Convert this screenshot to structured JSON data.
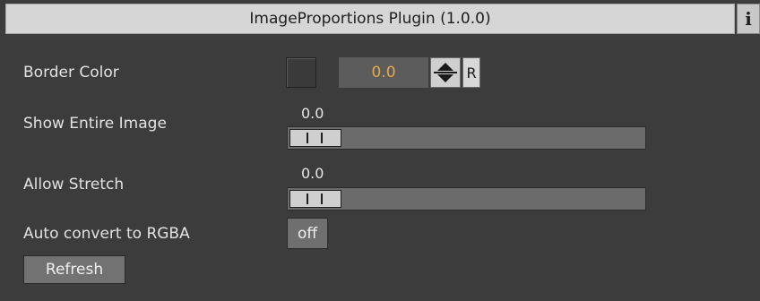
{
  "header": {
    "title": "ImageProportions Plugin (1.0.0)",
    "info_glyph": "i"
  },
  "border_color": {
    "label": "Border Color",
    "value": "0.0",
    "reset_label": "R",
    "swatch_color": "#3a3a3a",
    "value_color": "#e6a64a"
  },
  "show_entire_image": {
    "label": "Show Entire Image",
    "value": "0.0",
    "slider_fraction": 0.0
  },
  "allow_stretch": {
    "label": "Allow Stretch",
    "value": "0.0",
    "slider_fraction": 0.0
  },
  "auto_convert": {
    "label": "Auto convert to RGBA",
    "toggle_label": "off"
  },
  "refresh": {
    "label": "Refresh"
  },
  "icons": {
    "info": "info-icon",
    "spinner": "spinner-arrows-icon",
    "slider_thumb": "slider-thumb"
  }
}
